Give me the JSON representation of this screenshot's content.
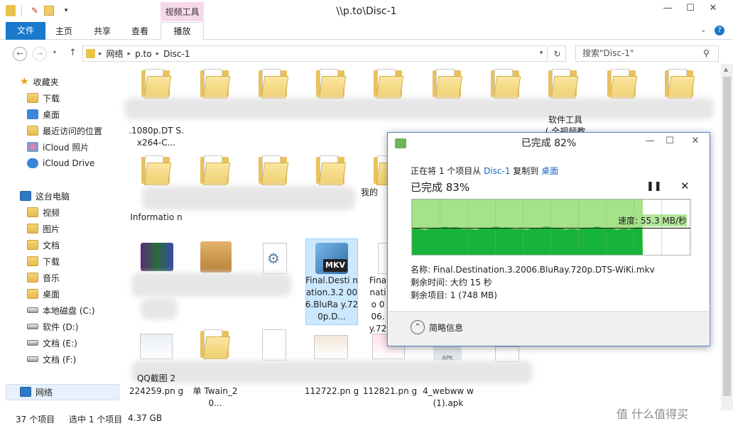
{
  "window": {
    "title": "\\\\p.to\\Disc-1",
    "context_tab": "视频工具",
    "min": "—",
    "max": "☐",
    "close": "✕"
  },
  "ribbon": {
    "tabs": [
      "文件",
      "主页",
      "共享",
      "查看",
      "播放"
    ],
    "help": "?"
  },
  "address": {
    "segments": [
      "网络",
      "p.to",
      "Disc-1"
    ],
    "search_placeholder": "搜索\"Disc-1\""
  },
  "nav": {
    "items": [
      {
        "label": "收藏夹",
        "kind": "star"
      },
      {
        "label": "下载",
        "kind": "folder"
      },
      {
        "label": "桌面",
        "kind": "blue"
      },
      {
        "label": "最近访问的位置",
        "kind": "folder"
      },
      {
        "label": "iCloud 照片",
        "kind": "blue"
      },
      {
        "label": "iCloud Drive",
        "kind": "blue"
      },
      {
        "label": "这台电脑",
        "kind": "pc"
      },
      {
        "label": "视频",
        "kind": "folder"
      },
      {
        "label": "图片",
        "kind": "folder"
      },
      {
        "label": "文档",
        "kind": "folder"
      },
      {
        "label": "下载",
        "kind": "folder"
      },
      {
        "label": "音乐",
        "kind": "folder"
      },
      {
        "label": "桌面",
        "kind": "folder"
      },
      {
        "label": "本地磁盘 (C:)",
        "kind": "drive"
      },
      {
        "label": "软件 (D:)",
        "kind": "drive"
      },
      {
        "label": "文档 (E:)",
        "kind": "drive"
      },
      {
        "label": "文档 (F:)",
        "kind": "drive"
      },
      {
        "label": "网络",
        "kind": "pc"
      }
    ]
  },
  "files": {
    "row1_label1": ".1080p.DT S.x264-C...",
    "row1_label2": "( 全视频教",
    "row1_label2b": "软件工具",
    "row2_label1": "Informatio n",
    "row2_label2": "我的",
    "mkv_label": "Final.Desti nation.3.2 006.BluRa y.720p.D...",
    "mkv_badge": "MKV",
    "fina_label": "Fina natio 006. y.72",
    "r4_l1": "224259.pn g",
    "r4_l1_top": "QQ截图 2",
    "r4_l2": "单 Twain_20...",
    "r4_l3": "112722.pn g",
    "r4_l4": "112821.pn g",
    "r4_l5": "4_webww w (1).apk",
    "apk_badge": "APK"
  },
  "status": {
    "count": "37 个项目",
    "selected": "选中 1 个项目",
    "size": "4.37 GB"
  },
  "dialog": {
    "title": "已完成 82%",
    "line_prefix": "正在将 1 个项目从 ",
    "from": "Disc-1",
    "line_mid": " 复制到 ",
    "to": "桌面",
    "percent": "已完成 83%",
    "pause": "❚❚",
    "cancel": "✕",
    "speed": "速度: 55.3 MB/秒",
    "name": "名称: Final.Destination.3.2006.BluRay.720p.DTS-WiKi.mkv",
    "time": "剩余时间: 大约 15 秒",
    "items": "剩余项目: 1 (748 MB)",
    "less": "简略信息"
  },
  "chart_data": {
    "type": "area",
    "progress_percent": 83,
    "speed": "55.3 MB/秒"
  },
  "watermark": "值 什么值得买"
}
